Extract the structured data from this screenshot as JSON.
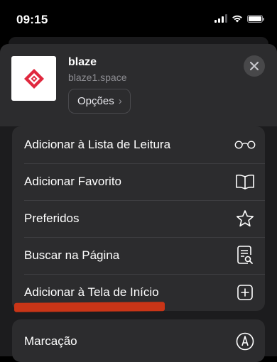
{
  "status_bar": {
    "time": "09:15",
    "battery_level": 1.0
  },
  "sheet": {
    "site": {
      "title": "blaze",
      "url": "blaze1.space",
      "icon": "blaze-logo",
      "accent": "#e0283e"
    },
    "options_label": "Opções",
    "options_chevron": "›",
    "close_icon": "close-icon"
  },
  "menu": {
    "items": [
      {
        "label": "Adicionar à Lista de Leitura",
        "icon": "glasses-icon"
      },
      {
        "label": "Adicionar Favorito",
        "icon": "book-icon"
      },
      {
        "label": "Preferidos",
        "icon": "star-icon"
      },
      {
        "label": "Buscar na Página",
        "icon": "find-in-page-icon"
      },
      {
        "label": "Adicionar à Tela de Início",
        "icon": "add-to-home-icon"
      }
    ],
    "secondary": [
      {
        "label": "Marcação",
        "icon": "markup-icon"
      }
    ]
  },
  "annotation_color": "#c93517"
}
